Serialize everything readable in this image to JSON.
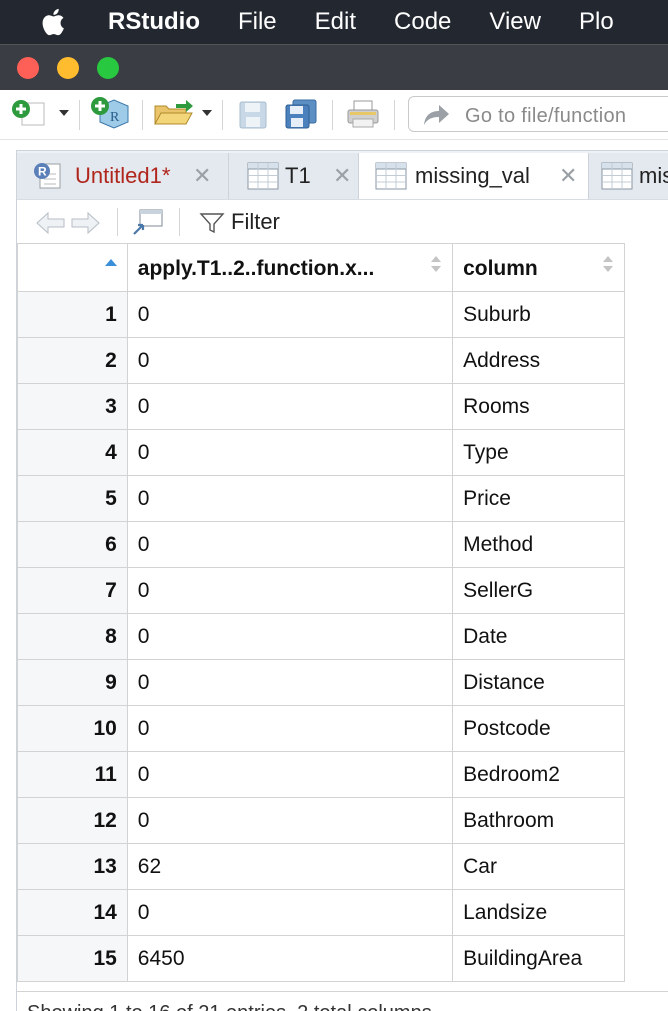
{
  "menubar": {
    "app_name": "RStudio",
    "menus": [
      "File",
      "Edit",
      "Code",
      "View",
      "Plo"
    ]
  },
  "toolbar": {
    "goto_placeholder": "Go to file/function"
  },
  "tabs": [
    {
      "label": "Untitled1*",
      "icon": "r-script-icon",
      "color": "#b0251c"
    },
    {
      "label": "T1",
      "icon": "grid-icon"
    },
    {
      "label": "missing_val",
      "icon": "grid-icon",
      "active": true
    },
    {
      "label": "mis",
      "icon": "grid-icon"
    }
  ],
  "datatool": {
    "filter_label": "Filter"
  },
  "table": {
    "columns": [
      "apply.T1..2..function.x...",
      "column"
    ],
    "rows": [
      {
        "n": "1",
        "value": "0",
        "column": "Suburb"
      },
      {
        "n": "2",
        "value": "0",
        "column": "Address"
      },
      {
        "n": "3",
        "value": "0",
        "column": "Rooms"
      },
      {
        "n": "4",
        "value": "0",
        "column": "Type"
      },
      {
        "n": "5",
        "value": "0",
        "column": "Price"
      },
      {
        "n": "6",
        "value": "0",
        "column": "Method"
      },
      {
        "n": "7",
        "value": "0",
        "column": "SellerG"
      },
      {
        "n": "8",
        "value": "0",
        "column": "Date"
      },
      {
        "n": "9",
        "value": "0",
        "column": "Distance"
      },
      {
        "n": "10",
        "value": "0",
        "column": "Postcode"
      },
      {
        "n": "11",
        "value": "0",
        "column": "Bedroom2"
      },
      {
        "n": "12",
        "value": "0",
        "column": "Bathroom"
      },
      {
        "n": "13",
        "value": "62",
        "column": "Car"
      },
      {
        "n": "14",
        "value": "0",
        "column": "Landsize"
      },
      {
        "n": "15",
        "value": "6450",
        "column": "BuildingArea"
      }
    ]
  },
  "status": {
    "text": "Showing 1 to 16 of 21 entries, 2 total columns"
  }
}
